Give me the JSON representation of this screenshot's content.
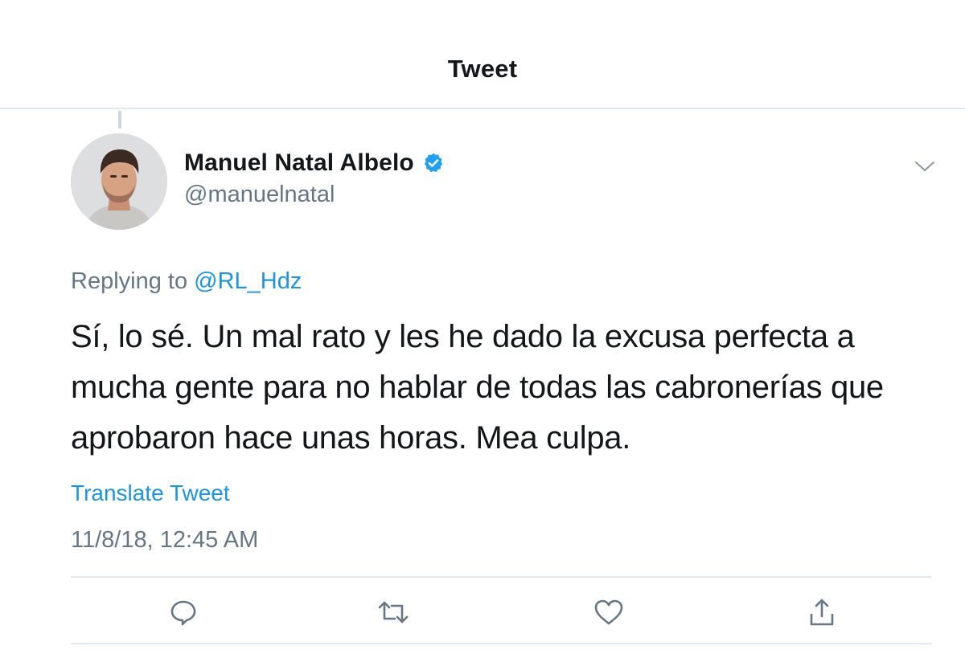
{
  "header": {
    "title": "Tweet"
  },
  "author": {
    "display_name": "Manuel Natal Albelo",
    "handle": "@manuelnatal",
    "verified": true,
    "avatar_icon": "avatar-photo"
  },
  "tweet": {
    "replying_prefix": "Replying to",
    "replying_to": "@RL_Hdz",
    "text": "Sí, lo sé. Un mal rato y les he dado la excusa perfecta a mucha gente para no hablar de todas las cabronerías que aprobaron hace unas horas. Mea culpa.",
    "translate_label": "Translate Tweet",
    "timestamp": "11/8/18, 12:45 AM"
  },
  "actions": [
    {
      "icon": "reply-icon"
    },
    {
      "icon": "retweet-icon"
    },
    {
      "icon": "like-icon"
    },
    {
      "icon": "share-icon"
    }
  ],
  "colors": {
    "accent": "#1b95e0",
    "secondary_text": "#657786",
    "primary_text": "#14171a",
    "divider": "#e1e8ed",
    "verified": "#1da1f2"
  }
}
